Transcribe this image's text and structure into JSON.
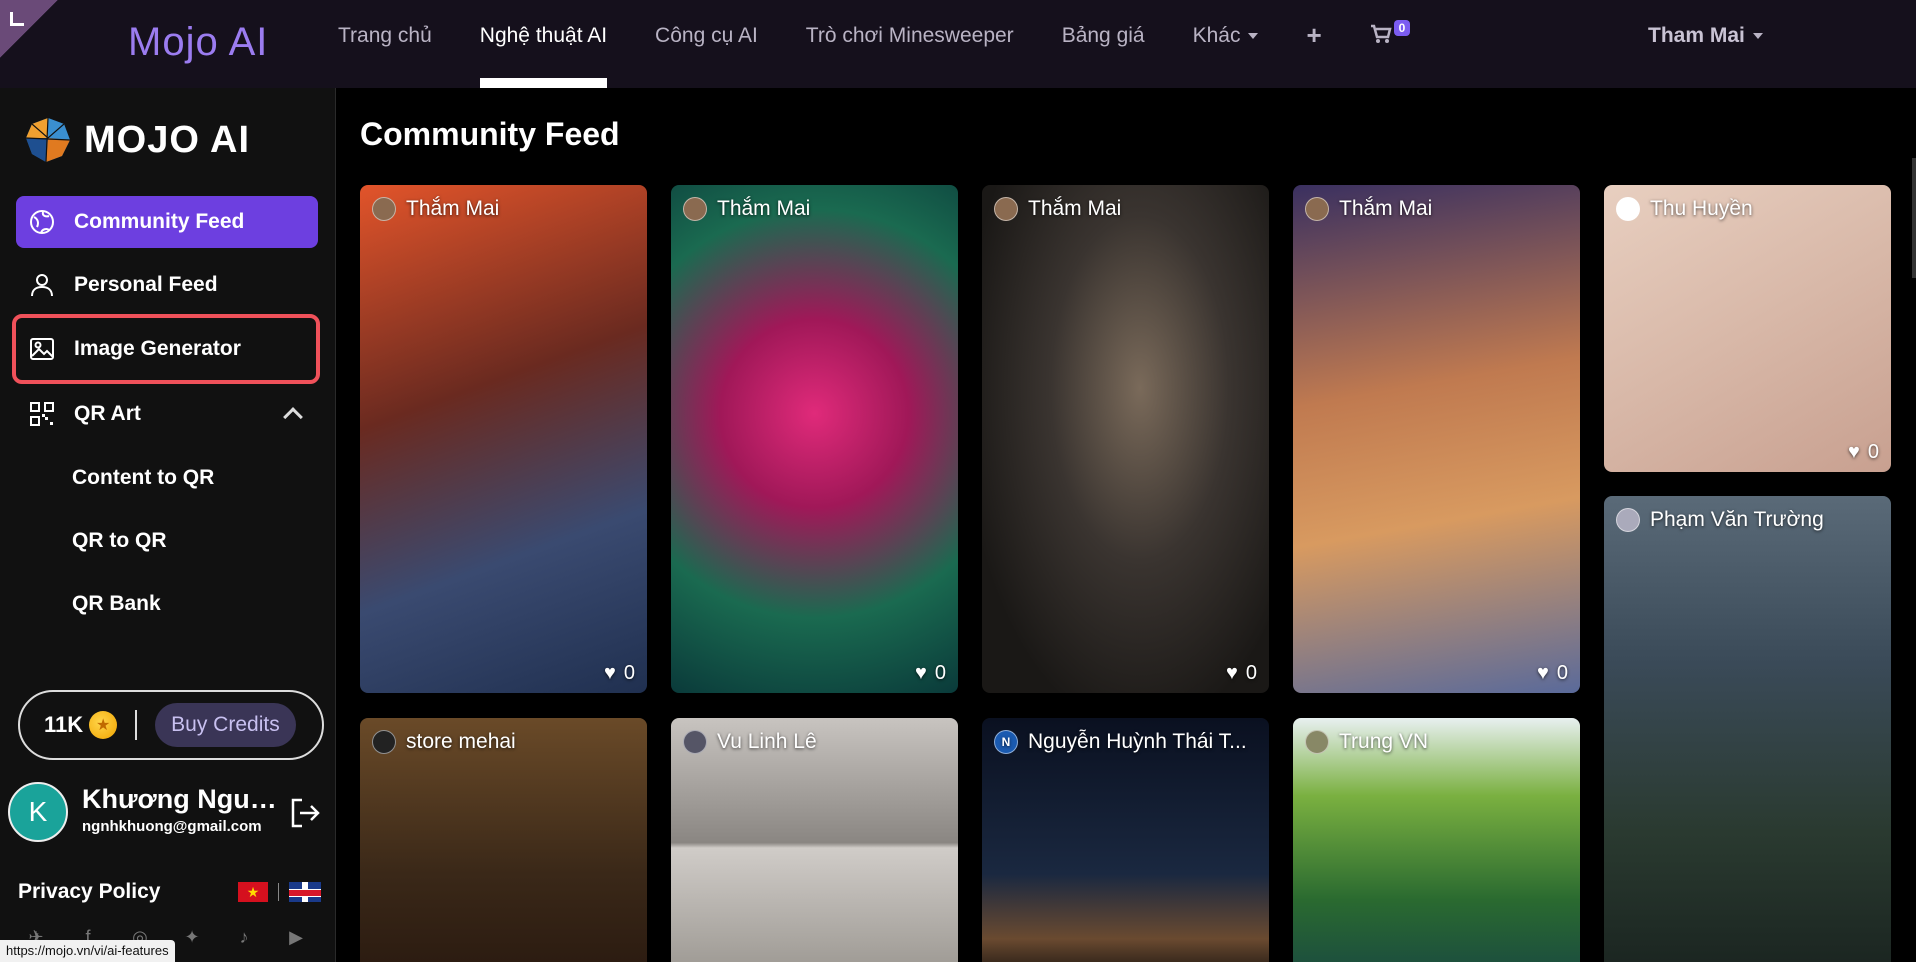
{
  "topnav": {
    "brand": "Mojo AI",
    "links": [
      "Trang chủ",
      "Nghệ thuật AI",
      "Công cụ AI",
      "Trò chơi Minesweeper",
      "Bảng giá",
      "Khác"
    ],
    "active_index": 1,
    "plus": "+",
    "cart_count": "0",
    "user": "Tham Mai"
  },
  "sidebar": {
    "logo_text": "MOJO AI",
    "items": [
      {
        "label": "Community Feed"
      },
      {
        "label": "Personal Feed"
      },
      {
        "label": "Image Generator"
      },
      {
        "label": "QR Art"
      }
    ],
    "subitems": [
      "Content to QR",
      "QR to QR",
      "QR Bank"
    ],
    "credits": "11K",
    "buy_label": "Buy Credits",
    "user_name": "Khương Nguy...",
    "user_email": "ngnhkhuong@gmail.com",
    "privacy": "Privacy Policy",
    "socials": [
      "telegram-icon",
      "facebook-icon",
      "instagram-icon",
      "twitter-icon",
      "tiktok-icon",
      "youtube-icon"
    ]
  },
  "main": {
    "title": "Community Feed",
    "cards": [
      {
        "author": "Thắm Mai",
        "likes": "0"
      },
      {
        "author": "Thắm Mai",
        "likes": "0"
      },
      {
        "author": "Thắm Mai",
        "likes": "0"
      },
      {
        "author": "Thắm Mai",
        "likes": "0"
      },
      {
        "author": "Thu Huyền",
        "likes": "0"
      },
      {
        "author": "Phạm Văn Trường",
        "likes": ""
      },
      {
        "author": "store mehai",
        "likes": ""
      },
      {
        "author": "Vu Linh Lê",
        "likes": ""
      },
      {
        "author": "Nguyễn Huỳnh Thái T...",
        "likes": "",
        "avatar_letter": "N"
      },
      {
        "author": "Trung VN",
        "likes": ""
      }
    ]
  },
  "status_url": "https://mojo.vn/vi/ai-features",
  "colors": {
    "brand": "#9b7cf0",
    "active_item": "#6d3fe0",
    "highlight_border": "#f0515a"
  }
}
